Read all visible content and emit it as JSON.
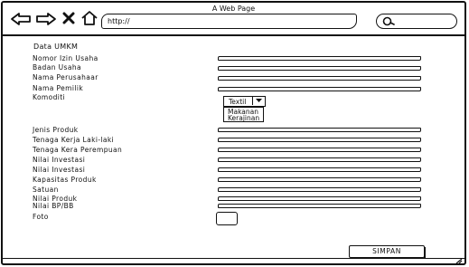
{
  "browser": {
    "title": "A Web Page",
    "url": "http://",
    "icons": {
      "back": "back-arrow-icon",
      "forward": "forward-arrow-icon",
      "close": "close-icon",
      "home": "home-icon",
      "search": "search-icon"
    }
  },
  "form": {
    "heading": "Data UMKM",
    "labels": {
      "nomor_izin_usaha": "Nomor Izin Usaha",
      "badan_usaha": "Badan Usaha",
      "nama_perusahaan": "Nama Perusahaar",
      "nama_pemilik": "Nama Pemilik",
      "komoditi": "Komoditi",
      "jenis_produk": "Jenis Produk",
      "tenaga_kerja_laki": "Tenaga Kerja Laki-laki",
      "tenaga_kera_perempuan": "Tenaga Kera Perempuan",
      "nilai_investasi_1": "Nilai Investasi",
      "nilai_investasi_2": "Nilai Investasi",
      "kapasitas_produk": "Kapasitas Produk",
      "satuan": "Satuan",
      "nilai_produk": "Nilai Produk",
      "nilai_bp_bb": "Nilai BP/BB",
      "foto": "Foto"
    },
    "komoditi_select": {
      "selected": "Textil",
      "options": [
        "Makanan",
        "Kerajinan"
      ]
    },
    "save_label": "SIMPAN"
  }
}
